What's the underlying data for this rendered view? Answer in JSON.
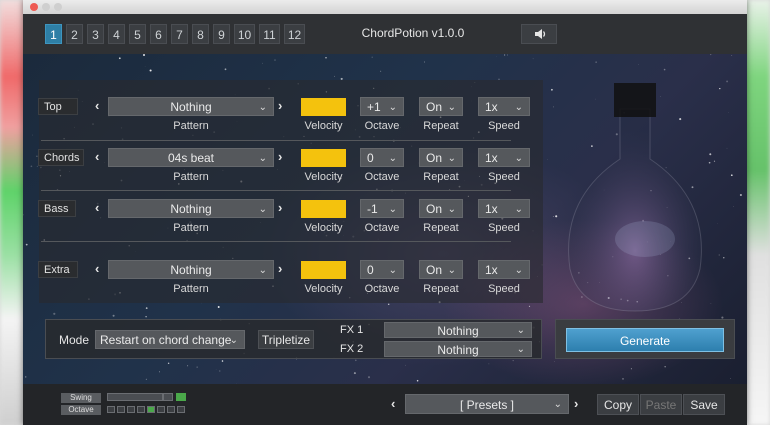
{
  "app_title": "ChordPotion v1.0.0",
  "pattern_tabs": [
    "1",
    "2",
    "3",
    "4",
    "5",
    "6",
    "7",
    "8",
    "9",
    "10",
    "11",
    "12"
  ],
  "active_tab": "1",
  "rows": [
    {
      "label": "Top",
      "pattern": "Nothing",
      "octave": "+1",
      "repeat": "On",
      "speed": "1x"
    },
    {
      "label": "Chords",
      "pattern": "04s beat",
      "octave": "0",
      "repeat": "On",
      "speed": "1x"
    },
    {
      "label": "Bass",
      "pattern": "Nothing",
      "octave": "-1",
      "repeat": "On",
      "speed": "1x"
    },
    {
      "label": "Extra",
      "pattern": "Nothing",
      "octave": "0",
      "repeat": "On",
      "speed": "1x"
    }
  ],
  "column_labels": {
    "pattern": "Pattern",
    "velocity": "Velocity",
    "octave": "Octave",
    "repeat": "Repeat",
    "speed": "Speed"
  },
  "velocity_color": "#f4c20d",
  "mode": {
    "label": "Mode",
    "value": "Restart on chord change",
    "tripletize": "Tripletize"
  },
  "fx": [
    {
      "label": "FX 1",
      "value": "Nothing"
    },
    {
      "label": "FX 2",
      "value": "Nothing"
    }
  ],
  "generate_label": "Generate",
  "footer": {
    "swing_label": "Swing",
    "octave_label": "Octave",
    "presets": "[ Presets ]",
    "copy": "Copy",
    "paste": "Paste",
    "save": "Save"
  },
  "accent_color": "#2e7fa6"
}
